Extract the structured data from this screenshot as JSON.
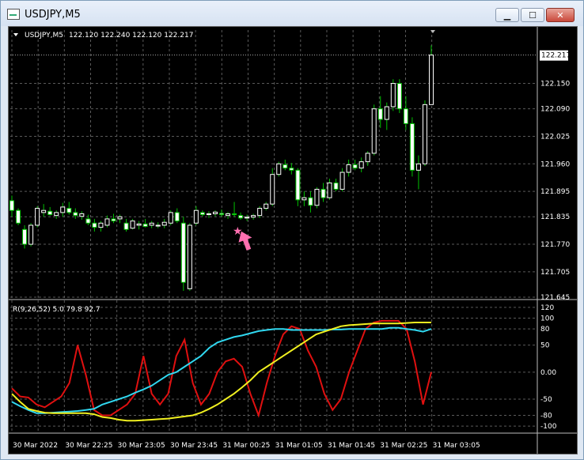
{
  "window": {
    "title": "USDJPY,M5",
    "min_label": "▁",
    "max_label": "☐",
    "close_label": "✕"
  },
  "colors": {
    "background": "#000000",
    "candle_up": "#ffffff",
    "candle_down": "#ffffff",
    "wick": "#00c000",
    "grid": "#5a5a5a",
    "rsi_fast": "#e01010",
    "rsi_mid": "#30d8f0",
    "rsi_slow": "#f0f020",
    "signal": "#ff6fb0"
  },
  "chart_data": [
    {
      "type": "candlestick",
      "title": "USDJPY,M5  122.120 122.240 122.120 122.217",
      "symbol": "USDJPY,M5",
      "ohlc_header": "122.120 122.240 122.120 122.217",
      "current_price": "122.217",
      "y_ticks": [
        "122.150",
        "122.090",
        "122.025",
        "121.960",
        "121.895",
        "121.835",
        "121.770",
        "121.705",
        "121.645"
      ],
      "ylim": [
        121.645,
        122.25
      ],
      "x_labels": [
        "30 Mar 2022",
        "30 Mar 22:25",
        "30 Mar 23:05",
        "30 Mar 23:45",
        "31 Mar 00:25",
        "31 Mar 01:05",
        "31 Mar 01:45",
        "31 Mar 02:25",
        "31 Mar 03:05"
      ],
      "candles": [
        {
          "o": 121.873,
          "h": 121.885,
          "l": 121.835,
          "c": 121.85
        },
        {
          "o": 121.85,
          "h": 121.855,
          "l": 121.815,
          "c": 121.82
        },
        {
          "o": 121.805,
          "h": 121.815,
          "l": 121.76,
          "c": 121.77
        },
        {
          "o": 121.77,
          "h": 121.82,
          "l": 121.765,
          "c": 121.815
        },
        {
          "o": 121.815,
          "h": 121.86,
          "l": 121.81,
          "c": 121.855
        },
        {
          "o": 121.845,
          "h": 121.865,
          "l": 121.835,
          "c": 121.85
        },
        {
          "o": 121.848,
          "h": 121.858,
          "l": 121.838,
          "c": 121.84
        },
        {
          "o": 121.838,
          "h": 121.85,
          "l": 121.83,
          "c": 121.845
        },
        {
          "o": 121.845,
          "h": 121.868,
          "l": 121.835,
          "c": 121.858
        },
        {
          "o": 121.855,
          "h": 121.87,
          "l": 121.84,
          "c": 121.845
        },
        {
          "o": 121.845,
          "h": 121.855,
          "l": 121.83,
          "c": 121.838
        },
        {
          "o": 121.836,
          "h": 121.848,
          "l": 121.828,
          "c": 121.842
        },
        {
          "o": 121.83,
          "h": 121.84,
          "l": 121.815,
          "c": 121.82
        },
        {
          "o": 121.82,
          "h": 121.83,
          "l": 121.8,
          "c": 121.81
        },
        {
          "o": 121.81,
          "h": 121.825,
          "l": 121.8,
          "c": 121.82
        },
        {
          "o": 121.815,
          "h": 121.838,
          "l": 121.81,
          "c": 121.83
        },
        {
          "o": 121.83,
          "h": 121.842,
          "l": 121.82,
          "c": 121.825
        },
        {
          "o": 121.83,
          "h": 121.84,
          "l": 121.82,
          "c": 121.835
        },
        {
          "o": 121.82,
          "h": 121.83,
          "l": 121.8,
          "c": 121.805
        },
        {
          "o": 121.808,
          "h": 121.83,
          "l": 121.805,
          "c": 121.825
        },
        {
          "o": 121.815,
          "h": 121.825,
          "l": 121.805,
          "c": 121.818
        },
        {
          "o": 121.818,
          "h": 121.83,
          "l": 121.81,
          "c": 121.812
        },
        {
          "o": 121.815,
          "h": 121.825,
          "l": 121.808,
          "c": 121.82
        },
        {
          "o": 121.813,
          "h": 121.822,
          "l": 121.808,
          "c": 121.815
        },
        {
          "o": 121.815,
          "h": 121.83,
          "l": 121.808,
          "c": 121.822
        },
        {
          "o": 121.82,
          "h": 121.85,
          "l": 121.815,
          "c": 121.845
        },
        {
          "o": 121.845,
          "h": 121.855,
          "l": 121.82,
          "c": 121.825
        },
        {
          "o": 121.82,
          "h": 121.835,
          "l": 121.66,
          "c": 121.68
        },
        {
          "o": 121.665,
          "h": 121.82,
          "l": 121.66,
          "c": 121.815
        },
        {
          "o": 121.82,
          "h": 121.86,
          "l": 121.815,
          "c": 121.85
        },
        {
          "o": 121.845,
          "h": 121.85,
          "l": 121.835,
          "c": 121.84
        },
        {
          "o": 121.84,
          "h": 121.848,
          "l": 121.832,
          "c": 121.842
        },
        {
          "o": 121.842,
          "h": 121.85,
          "l": 121.836,
          "c": 121.846
        },
        {
          "o": 121.843,
          "h": 121.852,
          "l": 121.835,
          "c": 121.84
        },
        {
          "o": 121.838,
          "h": 121.846,
          "l": 121.83,
          "c": 121.842
        },
        {
          "o": 121.842,
          "h": 121.87,
          "l": 121.835,
          "c": 121.84
        },
        {
          "o": 121.838,
          "h": 121.845,
          "l": 121.828,
          "c": 121.832
        },
        {
          "o": 121.832,
          "h": 121.84,
          "l": 121.825,
          "c": 121.834
        },
        {
          "o": 121.834,
          "h": 121.842,
          "l": 121.828,
          "c": 121.838
        },
        {
          "o": 121.838,
          "h": 121.86,
          "l": 121.832,
          "c": 121.855
        },
        {
          "o": 121.855,
          "h": 121.87,
          "l": 121.85,
          "c": 121.865
        },
        {
          "o": 121.865,
          "h": 121.95,
          "l": 121.86,
          "c": 121.935
        },
        {
          "o": 121.935,
          "h": 121.965,
          "l": 121.93,
          "c": 121.96
        },
        {
          "o": 121.958,
          "h": 121.97,
          "l": 121.945,
          "c": 121.95
        },
        {
          "o": 121.95,
          "h": 121.962,
          "l": 121.935,
          "c": 121.945
        },
        {
          "o": 121.945,
          "h": 121.95,
          "l": 121.86,
          "c": 121.875
        },
        {
          "o": 121.875,
          "h": 121.895,
          "l": 121.86,
          "c": 121.88
        },
        {
          "o": 121.88,
          "h": 121.895,
          "l": 121.845,
          "c": 121.862
        },
        {
          "o": 121.862,
          "h": 121.905,
          "l": 121.855,
          "c": 121.9
        },
        {
          "o": 121.9,
          "h": 121.915,
          "l": 121.87,
          "c": 121.88
        },
        {
          "o": 121.88,
          "h": 121.925,
          "l": 121.875,
          "c": 121.915
        },
        {
          "o": 121.915,
          "h": 121.925,
          "l": 121.895,
          "c": 121.9
        },
        {
          "o": 121.9,
          "h": 121.95,
          "l": 121.895,
          "c": 121.94
        },
        {
          "o": 121.94,
          "h": 121.97,
          "l": 121.93,
          "c": 121.958
        },
        {
          "o": 121.958,
          "h": 121.97,
          "l": 121.945,
          "c": 121.95
        },
        {
          "o": 121.95,
          "h": 121.975,
          "l": 121.94,
          "c": 121.965
        },
        {
          "o": 121.965,
          "h": 121.99,
          "l": 121.955,
          "c": 121.985
        },
        {
          "o": 121.985,
          "h": 122.1,
          "l": 121.98,
          "c": 122.09
        },
        {
          "o": 122.09,
          "h": 122.12,
          "l": 122.045,
          "c": 122.065
        },
        {
          "o": 122.065,
          "h": 122.105,
          "l": 122.04,
          "c": 122.095
        },
        {
          "o": 122.095,
          "h": 122.16,
          "l": 122.085,
          "c": 122.15
        },
        {
          "o": 122.15,
          "h": 122.16,
          "l": 122.08,
          "c": 122.09
        },
        {
          "o": 122.09,
          "h": 122.12,
          "l": 122.04,
          "c": 122.055
        },
        {
          "o": 122.055,
          "h": 122.07,
          "l": 121.93,
          "c": 121.945
        },
        {
          "o": 121.945,
          "h": 121.98,
          "l": 121.9,
          "c": 121.96
        },
        {
          "o": 121.96,
          "h": 122.11,
          "l": 121.955,
          "c": 122.1
        },
        {
          "o": 122.1,
          "h": 122.24,
          "l": 122.1,
          "c": 122.217
        }
      ]
    },
    {
      "type": "line",
      "title": "R(9,26,52) 5.0 79.8 92.7",
      "y_ticks": [
        "120",
        "100",
        "80",
        "50",
        "0.00",
        "-50",
        "-80",
        "-100"
      ],
      "ylim": [
        -110,
        130
      ],
      "series": [
        {
          "values": [
            -30,
            -45,
            -47,
            -60,
            -65,
            -55,
            -45,
            -20,
            50,
            -5,
            -70,
            -80,
            -80,
            -70,
            -60,
            -40,
            30,
            -40,
            -60,
            -40,
            30,
            60,
            -20,
            -60,
            -40,
            0,
            20,
            25,
            10,
            -40,
            -80,
            -20,
            30,
            70,
            85,
            80,
            40,
            10,
            -40,
            -70,
            -50,
            0,
            40,
            80,
            92,
            95,
            95,
            95,
            80,
            20,
            -60,
            0
          ]
        },
        {
          "values": [
            -55,
            -63,
            -70,
            -76,
            -76,
            -75,
            -74,
            -73,
            -72,
            -70,
            -68,
            -60,
            -55,
            -50,
            -45,
            -38,
            -32,
            -25,
            -15,
            -5,
            0,
            10,
            20,
            30,
            45,
            55,
            60,
            65,
            68,
            72,
            76,
            78,
            80,
            80,
            78,
            78,
            78,
            78,
            78,
            79,
            79,
            80,
            80,
            80,
            80,
            80,
            82,
            82,
            80,
            78,
            75,
            80
          ]
        },
        {
          "values": [
            -40,
            -55,
            -68,
            -72,
            -75,
            -76,
            -76,
            -76,
            -76,
            -76,
            -78,
            -83,
            -85,
            -88,
            -90,
            -90,
            -89,
            -88,
            -87,
            -86,
            -84,
            -82,
            -80,
            -75,
            -68,
            -60,
            -50,
            -40,
            -28,
            -15,
            0,
            10,
            20,
            30,
            40,
            50,
            60,
            70,
            75,
            80,
            85,
            87,
            88,
            89,
            90,
            90,
            90,
            90,
            91,
            92,
            92,
            92
          ]
        }
      ]
    }
  ]
}
